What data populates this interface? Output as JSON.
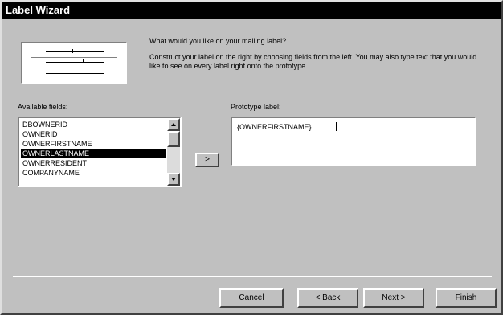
{
  "window": {
    "title": "Label Wizard"
  },
  "intro": {
    "question": "What would you like on your mailing label?",
    "description": "Construct your label on the right by choosing fields from the left. You may also type text that you would like to see on every label right onto the prototype."
  },
  "available_fields": {
    "label": "Available fields:",
    "items": [
      "DBOWNERID",
      "OWNERID",
      "OWNERFIRSTNAME",
      "OWNERLASTNAME",
      "OWNERRESIDENT",
      "COMPANYNAME"
    ],
    "selected_index": 3
  },
  "add_button": {
    "label": ">"
  },
  "prototype": {
    "label": "Prototype label:",
    "lines": [
      "{OWNERFIRSTNAME}"
    ]
  },
  "buttons": {
    "cancel": "Cancel",
    "back": "< Back",
    "next": "Next >",
    "finish": "Finish"
  },
  "icons": {
    "scroll_up": "scroll-up-arrow-icon",
    "scroll_down": "scroll-down-arrow-icon",
    "preview": "label-preview-icon"
  }
}
